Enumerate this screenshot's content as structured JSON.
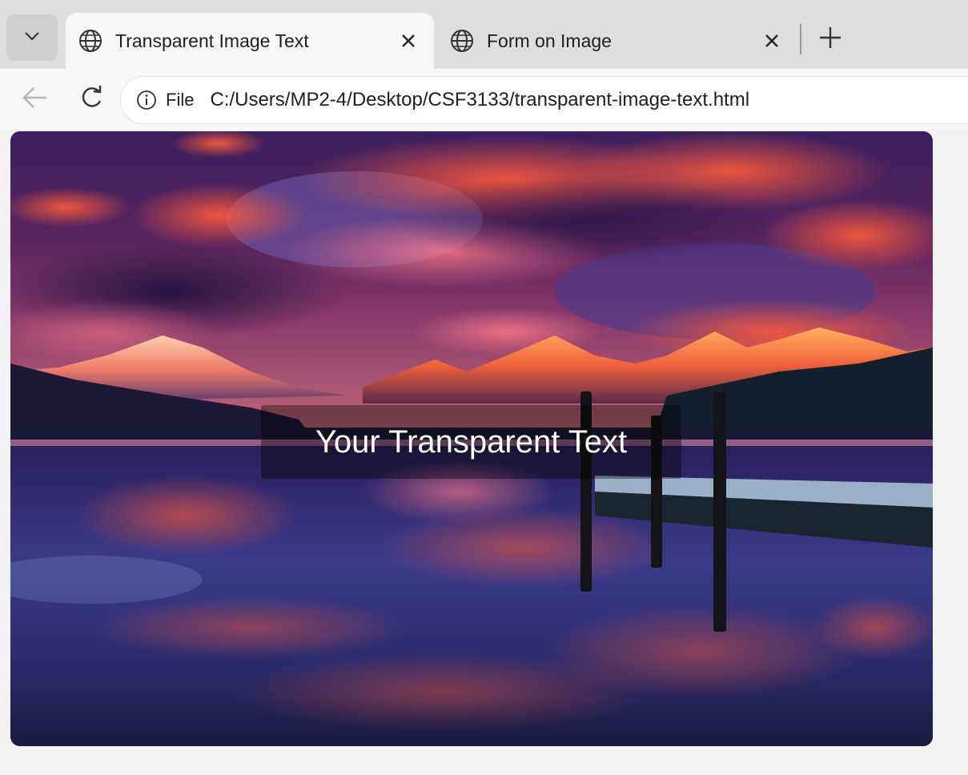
{
  "tabs": [
    {
      "title": "Transparent Image Text",
      "icon": "globe-icon",
      "active": true
    },
    {
      "title": "Form on Image",
      "icon": "globe-icon",
      "active": false
    }
  ],
  "toolbar": {
    "scheme_label": "File",
    "url": "C:/Users/MP2-4/Desktop/CSF3133/transparent-image-text.html"
  },
  "content": {
    "overlay_text": "Your Transparent Text"
  },
  "colors": {
    "tabstrip": "#dedede",
    "active_tab": "#f7f7f7",
    "overlay": "rgba(0,0,0,0.38)"
  }
}
